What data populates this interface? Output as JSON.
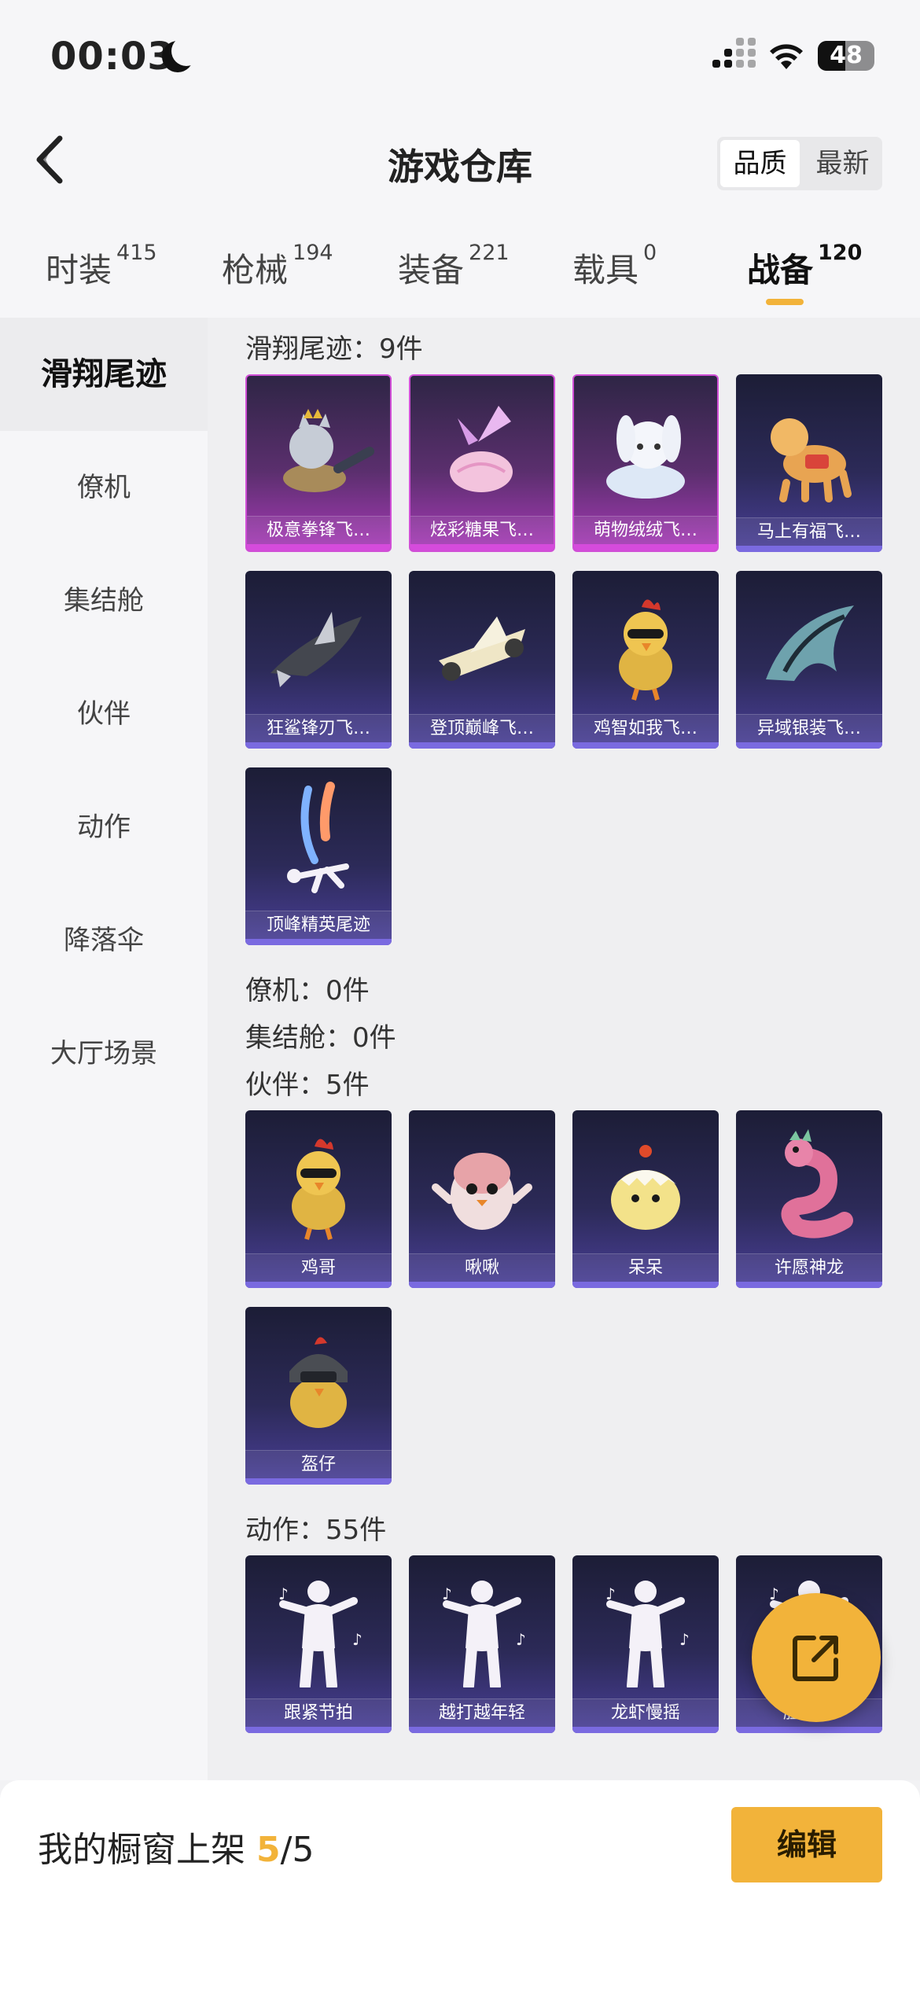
{
  "status": {
    "time": "00:03",
    "battery": "48",
    "battery_level": 0.48
  },
  "header": {
    "title": "游戏仓库",
    "sort_quality": "品质",
    "sort_newest": "最新"
  },
  "tabs": [
    {
      "label": "时装",
      "count": "415"
    },
    {
      "label": "枪械",
      "count": "194"
    },
    {
      "label": "装备",
      "count": "221"
    },
    {
      "label": "载具",
      "count": "0"
    },
    {
      "label": "战备",
      "count": "120"
    }
  ],
  "active_tab": 4,
  "sidebar": [
    "滑翔尾迹",
    "僚机",
    "集结舱",
    "伙伴",
    "动作",
    "降落伞",
    "大厅场景"
  ],
  "sections": [
    {
      "title": "滑翔尾迹：9件",
      "items": [
        {
          "label": "极意拳锋飞…",
          "rarity": "purple",
          "icon": "cat-plane-icon"
        },
        {
          "label": "炫彩糖果飞…",
          "rarity": "purple",
          "icon": "candy-icon"
        },
        {
          "label": "萌物绒绒飞…",
          "rarity": "purple",
          "icon": "bunny-icon"
        },
        {
          "label": "马上有福飞…",
          "rarity": "blue",
          "icon": "horse-icon"
        },
        {
          "label": "狂鲨锋刃飞…",
          "rarity": "blue",
          "icon": "shark-icon"
        },
        {
          "label": "登顶巅峰飞…",
          "rarity": "blue",
          "icon": "jet-icon"
        },
        {
          "label": "鸡智如我飞…",
          "rarity": "blue",
          "icon": "chicken-icon"
        },
        {
          "label": "异域银装飞…",
          "rarity": "blue",
          "icon": "wing-icon"
        },
        {
          "label": "顶峰精英尾迹",
          "rarity": "blue",
          "icon": "trail-icon"
        }
      ]
    },
    {
      "title": "僚机：0件",
      "items": []
    },
    {
      "title": "集结舱：0件",
      "items": []
    },
    {
      "title": "伙伴：5件",
      "items": [
        {
          "label": "鸡哥",
          "rarity": "blue",
          "icon": "chicken-icon"
        },
        {
          "label": "啾啾",
          "rarity": "blue",
          "icon": "bird-icon"
        },
        {
          "label": "呆呆",
          "rarity": "blue",
          "icon": "chick-icon"
        },
        {
          "label": "许愿神龙",
          "rarity": "blue",
          "icon": "dragon-icon"
        },
        {
          "label": "盔仔",
          "rarity": "blue",
          "icon": "helmet-chick-icon"
        }
      ]
    },
    {
      "title": "动作：55件",
      "items": [
        {
          "label": "跟紧节拍",
          "rarity": "blue",
          "icon": "dance-icon"
        },
        {
          "label": "越打越年轻",
          "rarity": "blue",
          "icon": "dance-icon"
        },
        {
          "label": "龙虾慢摇",
          "rarity": "blue",
          "icon": "dance-icon"
        },
        {
          "label": "胜利舞",
          "rarity": "blue",
          "icon": "dance-icon"
        }
      ]
    }
  ],
  "bottom": {
    "showcase_label": "我的橱窗上架 ",
    "showcase_used": "5",
    "showcase_total": "/5",
    "edit_label": "编辑"
  },
  "colors": {
    "accent": "#f2b33a",
    "purple_rarity": "#d04fd6",
    "blue_rarity": "#7a6ae0"
  }
}
